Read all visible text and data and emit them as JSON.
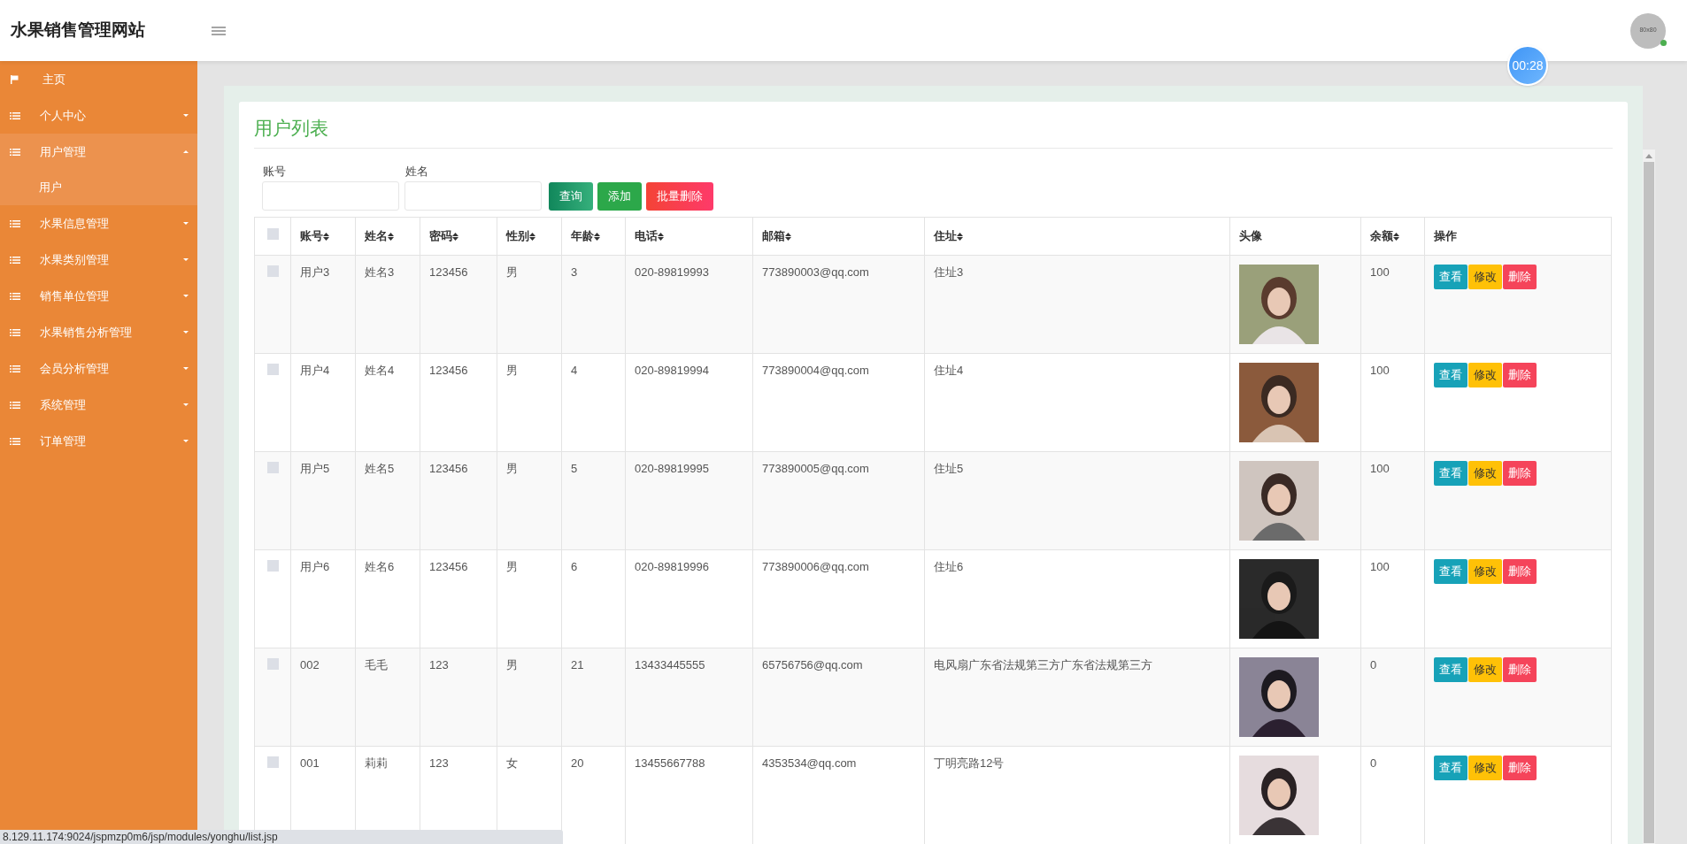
{
  "header": {
    "title": "水果销售管理网站",
    "avatar_text": "80x80",
    "online": true
  },
  "timer": "00:28",
  "sidebar": {
    "items": [
      {
        "label": "主页",
        "kind": "link",
        "expanded": false
      },
      {
        "label": "个人中心",
        "kind": "group",
        "expanded": false
      },
      {
        "label": "用户管理",
        "kind": "group",
        "expanded": true,
        "children": [
          {
            "label": "用户"
          }
        ]
      },
      {
        "label": "水果信息管理",
        "kind": "group",
        "expanded": false
      },
      {
        "label": "水果类别管理",
        "kind": "group",
        "expanded": false
      },
      {
        "label": "销售单位管理",
        "kind": "group",
        "expanded": false
      },
      {
        "label": "水果销售分析管理",
        "kind": "group",
        "expanded": false
      },
      {
        "label": "会员分析管理",
        "kind": "group",
        "expanded": false
      },
      {
        "label": "系统管理",
        "kind": "group",
        "expanded": false
      },
      {
        "label": "订单管理",
        "kind": "group",
        "expanded": false
      }
    ]
  },
  "panel": {
    "title": "用户列表",
    "search_fields": [
      {
        "label": "账号"
      },
      {
        "label": "姓名"
      }
    ],
    "buttons": [
      {
        "label": "查询",
        "kind": "query"
      },
      {
        "label": "添加",
        "kind": "add"
      },
      {
        "label": "批量删除",
        "kind": "delete"
      }
    ],
    "table": {
      "columns": [
        {
          "label": "账号",
          "sortable": true
        },
        {
          "label": "姓名",
          "sortable": true
        },
        {
          "label": "密码",
          "sortable": true
        },
        {
          "label": "性别",
          "sortable": true
        },
        {
          "label": "年龄",
          "sortable": true
        },
        {
          "label": "电话",
          "sortable": true
        },
        {
          "label": "邮箱",
          "sortable": true
        },
        {
          "label": "住址",
          "sortable": true
        },
        {
          "label": "头像",
          "sortable": false
        },
        {
          "label": "余额",
          "sortable": true
        },
        {
          "label": "操作",
          "sortable": false
        }
      ],
      "header_checked": false,
      "rows": [
        {
          "checked": false,
          "cells": [
            "用户3",
            "姓名3",
            "123456",
            "男",
            "3",
            "020-89819993",
            "773890003@qq.com",
            "住址3"
          ],
          "balance": "100",
          "actions": [
            "查看",
            "修改",
            "删除"
          ]
        },
        {
          "checked": false,
          "cells": [
            "用户4",
            "姓名4",
            "123456",
            "男",
            "4",
            "020-89819994",
            "773890004@qq.com",
            "住址4"
          ],
          "balance": "100",
          "actions": [
            "查看",
            "修改",
            "删除"
          ]
        },
        {
          "checked": false,
          "cells": [
            "用户5",
            "姓名5",
            "123456",
            "男",
            "5",
            "020-89819995",
            "773890005@qq.com",
            "住址5"
          ],
          "balance": "100",
          "actions": [
            "查看",
            "修改",
            "删除"
          ]
        },
        {
          "checked": false,
          "cells": [
            "用户6",
            "姓名6",
            "123456",
            "男",
            "6",
            "020-89819996",
            "773890006@qq.com",
            "住址6"
          ],
          "balance": "100",
          "actions": [
            "查看",
            "修改",
            "删除"
          ]
        },
        {
          "checked": false,
          "cells": [
            "002",
            "毛毛",
            "123",
            "男",
            "21",
            "13433445555",
            "65756756@qq.com",
            "电风扇广东省法规第三方广东省法规第三方"
          ],
          "balance": "0",
          "actions": [
            "查看",
            "修改",
            "删除"
          ]
        },
        {
          "checked": false,
          "cells": [
            "001",
            "莉莉",
            "123",
            "女",
            "20",
            "13455667788",
            "4353534@qq.com",
            "丁明亮路12号"
          ],
          "balance": "0",
          "actions": [
            "查看",
            "修改",
            "删除"
          ]
        }
      ]
    }
  },
  "status_bar": "8.129.11.174:9024/jspmzp0m6/jsp/modules/yonghu/list.jsp"
}
